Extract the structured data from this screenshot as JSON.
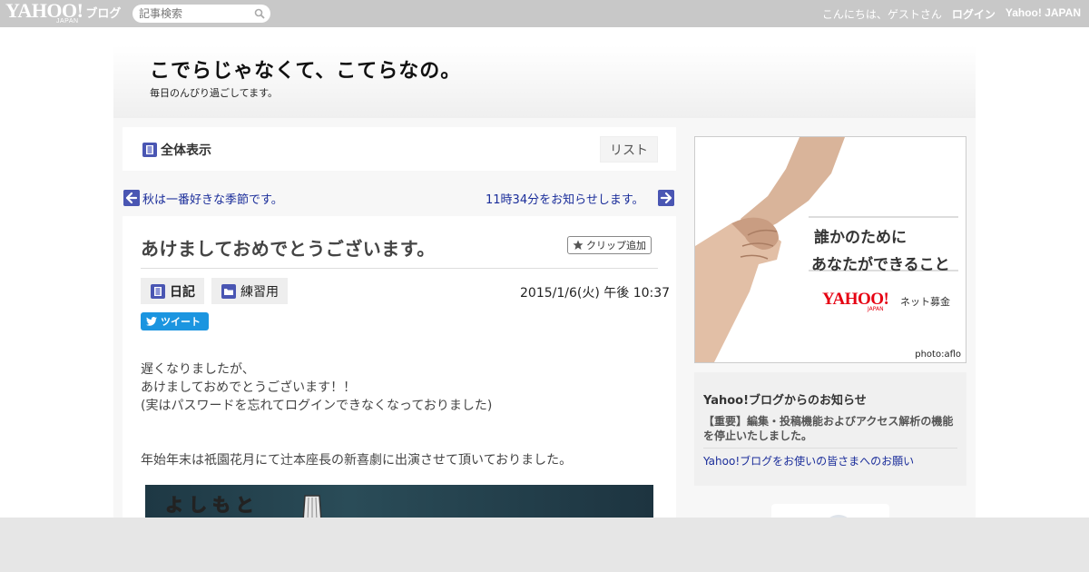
{
  "topbar": {
    "logo_text": "YAHOO!",
    "logo_japan": "JAPAN",
    "logo_blog": "ブログ",
    "search_placeholder": "記事検索",
    "greeting": "こんにちは、ゲストさん",
    "login": "ログイン",
    "yahoo_japan": "Yahoo! JAPAN"
  },
  "blog": {
    "title": "こでらじゃなくて、こてらなの。",
    "subtitle": "毎日のんびり過ごしてます。"
  },
  "nav": {
    "view_all": "全体表示",
    "list": "リスト",
    "prev": "秋は一番好きな季節です。",
    "next": "11時34分をお知らせします。"
  },
  "article": {
    "title": "あけましておめでとうございます。",
    "clip": "クリップ追加",
    "category": "日記",
    "folder": "練習用",
    "date": "2015/1/6(火) 午後 10:37",
    "tweet": "ツイート",
    "body": [
      "遅くなりましたが、",
      "あけましておめでとうございます！！",
      "(実はパスワードを忘れてログインできなくなっておりました)",
      "年始年末は祇園花月にて辻本座長の新喜劇に出演させて頂いておりました。"
    ],
    "photo_text": "よしもと"
  },
  "sidebar": {
    "ad": {
      "line1": "誰かのために",
      "line2": "あなたができること",
      "brand": "YAHOO!",
      "brand_japan": "JAPAN",
      "service": "ネット募金",
      "credit": "photo:aflo"
    },
    "notice": {
      "title": "Yahoo!ブログからのお知らせ",
      "item1": "【重要】編集・投稿機能およびアクセス解析の機能を停止いたしました。",
      "item2": "Yahoo!ブログをお使いの皆さまへのお願い"
    }
  },
  "colors": {
    "topbar": "#c8c8c8",
    "link": "#1a2d9a",
    "accent": "#4a56b3",
    "tweet": "#1b95e0",
    "yahoo_red": "#e60012"
  }
}
